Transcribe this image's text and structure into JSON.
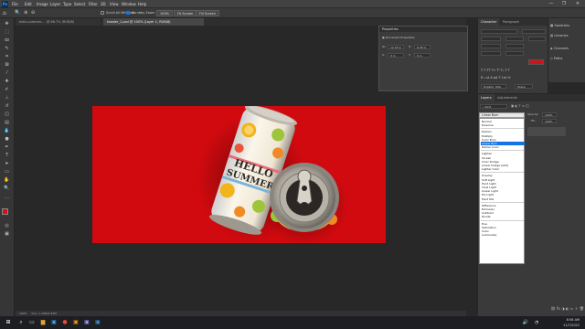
{
  "app": {
    "logo_text": "Ps",
    "menu": [
      "File",
      "Edit",
      "Image",
      "Layer",
      "Type",
      "Select",
      "Filter",
      "3D",
      "View",
      "Window",
      "Help"
    ]
  },
  "window_controls": {
    "minimize": "—",
    "restore": "❐",
    "close": "✕"
  },
  "options_bar": {
    "scroll_all_windows": "Scroll All Windows",
    "scrubby_zoom": "Scrubby Zoom",
    "zoom_value": "100%",
    "fit_screen": "Fit Screen",
    "fill_screen": "Fill Screen"
  },
  "tabs": [
    {
      "label": "hello-summer-... @ 66.7% (RGB/8)",
      "active": false
    },
    {
      "label": "header_1.psd @ 100% (Layer 1, RGB/8)",
      "active": true
    }
  ],
  "properties_panel": {
    "title": "Properties",
    "subtitle": "Document Properties",
    "w_label": "W:",
    "w_value": "12.23 in",
    "h_label": "H:",
    "h_value": "6.26 in",
    "x_label": "X:",
    "x_value": "0 in",
    "y_label": "Y:",
    "y_value": "0 in"
  },
  "character_panel": {
    "tabs": [
      "Character",
      "Paragraph"
    ],
    "color_hex": "#d0121a",
    "language": "English: USA",
    "aa": "Sharp"
  },
  "side_panels": [
    {
      "label": "Swatches",
      "icon": "swatches-icon"
    },
    {
      "label": "Libraries",
      "icon": "libraries-icon"
    },
    {
      "label": "Channels",
      "icon": "channels-icon"
    },
    {
      "label": "Paths",
      "icon": "paths-icon"
    }
  ],
  "layers_panel": {
    "tabs": [
      "Layers",
      "Adjustments"
    ],
    "kind_label": "Kind",
    "opacity_label": "Opacity:",
    "opacity_value": "100%",
    "fill_label": "Fill:",
    "fill_value": "100%"
  },
  "blend_mode": {
    "selected": "Linear Burn",
    "groups": [
      [
        "Normal",
        "Dissolve"
      ],
      [
        "Darken",
        "Multiply",
        "Color Burn",
        "Linear Burn",
        "Darker Color"
      ],
      [
        "Lighten",
        "Screen",
        "Color Dodge",
        "Linear Dodge (Add)",
        "Lighter Color"
      ],
      [
        "Overlay",
        "Soft Light",
        "Hard Light",
        "Vivid Light",
        "Linear Light",
        "Pin Light",
        "Hard Mix"
      ],
      [
        "Difference",
        "Exclusion",
        "Subtract",
        "Divide"
      ],
      [
        "Hue",
        "Saturation",
        "Color",
        "Luminosity"
      ]
    ]
  },
  "artwork": {
    "can_text_1": "HELLO",
    "can_text_2": "SUMMER",
    "background_color": "#d00a0f"
  },
  "status_bar": {
    "zoom": "100%",
    "doc": "Doc: 1.29M/1.87M"
  },
  "taskbar": {
    "time": "8:58 AM",
    "date": "11/7/2022"
  },
  "colors": {
    "fg": "#d0121a",
    "bg": "#ffffff"
  }
}
